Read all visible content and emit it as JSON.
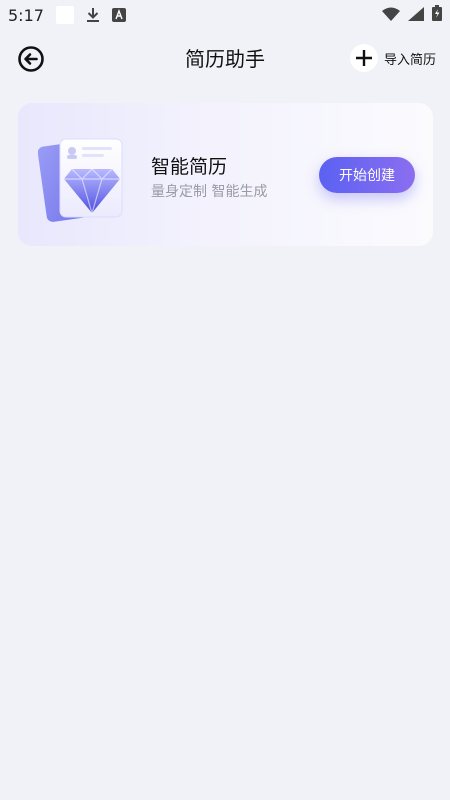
{
  "status_bar": {
    "time": "5:17",
    "icons": [
      "blank-notification-icon",
      "download-icon",
      "a-letter-icon",
      "wifi-icon",
      "signal-icon",
      "battery-icon"
    ]
  },
  "header": {
    "title": "简历助手",
    "back_icon": "back-arrow-circle-icon",
    "import_label": "导入简历",
    "import_icon": "plus-icon"
  },
  "card": {
    "title": "智能简历",
    "subtitle": "量身定制 智能生成",
    "button_label": "开始创建",
    "illustration": "resume-diamond-illustration"
  },
  "colors": {
    "background": "#f1f2f7",
    "accent_start": "#5b61f2",
    "accent_end": "#8b6ef0"
  }
}
